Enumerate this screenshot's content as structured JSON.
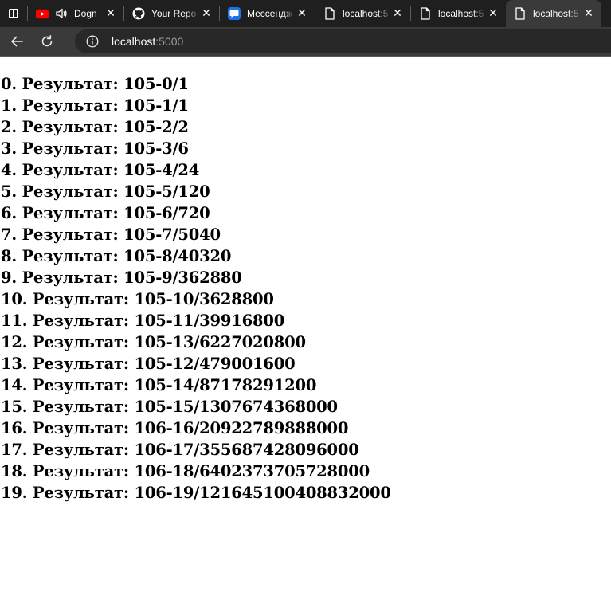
{
  "browser": {
    "tabs": [
      {
        "title": "Dogn",
        "favicon": "youtube-icon",
        "audio": true,
        "active": false
      },
      {
        "title": "Your Repo",
        "favicon": "github-icon",
        "active": false
      },
      {
        "title": "Мессендж",
        "favicon": "messenger-icon",
        "active": false
      },
      {
        "title": "localhost:5",
        "favicon": "page-icon",
        "active": false
      },
      {
        "title": "localhost:5",
        "favicon": "page-icon",
        "active": false
      },
      {
        "title": "localhost:5",
        "favicon": "page-icon",
        "active": true
      }
    ],
    "address": {
      "host": "localhost",
      "port": ":5000"
    },
    "colors": {
      "chrome_dark": "#1f1f1f",
      "toolbar": "#3a3a3a",
      "youtube_red": "#ff0000",
      "messenger_blue": "#1a73e8"
    }
  },
  "results": [
    "0. Результат: 105-0/1",
    "1. Результат: 105-1/1",
    "2. Результат: 105-2/2",
    "3. Результат: 105-3/6",
    "4. Результат: 105-4/24",
    "5. Результат: 105-5/120",
    "6. Результат: 105-6/720",
    "7. Результат: 105-7/5040",
    "8. Результат: 105-8/40320",
    "9. Результат: 105-9/362880",
    "10. Результат: 105-10/3628800",
    "11. Результат: 105-11/39916800",
    "12. Результат: 105-13/6227020800",
    "13. Результат: 105-12/479001600",
    "14. Результат: 105-14/87178291200",
    "15. Результат: 105-15/1307674368000",
    "16. Результат: 106-16/20922789888000",
    "17. Результат: 106-17/355687428096000",
    "18. Результат: 106-18/6402373705728000",
    "19. Результат: 106-19/121645100408832000"
  ]
}
